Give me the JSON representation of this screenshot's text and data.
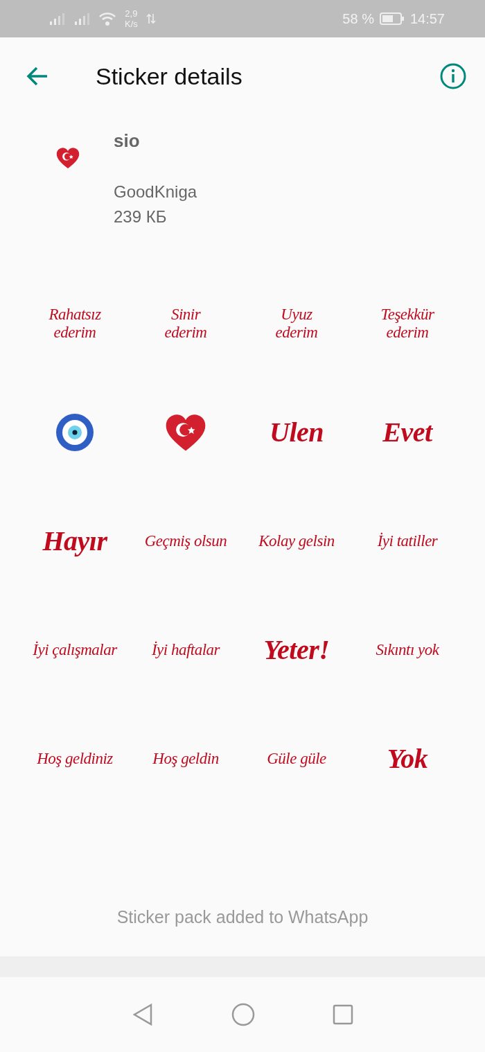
{
  "status_bar": {
    "network_speed": "2,9\nK/s",
    "battery": "58 %",
    "time": "14:57"
  },
  "app_bar": {
    "title": "Sticker details"
  },
  "pack": {
    "name": "sio",
    "publisher": "GoodKniga",
    "size": "239 КБ"
  },
  "stickers": [
    {
      "kind": "text",
      "label": "Rahatsız\nederim"
    },
    {
      "kind": "text",
      "label": "Sinir\nederim"
    },
    {
      "kind": "text",
      "label": "Uyuz\nederim"
    },
    {
      "kind": "text",
      "label": "Teşekkür\nederim"
    },
    {
      "kind": "eye"
    },
    {
      "kind": "heart"
    },
    {
      "kind": "big-text",
      "label": "Ulen"
    },
    {
      "kind": "big-text",
      "label": "Evet"
    },
    {
      "kind": "big-text",
      "label": "Hayır"
    },
    {
      "kind": "text",
      "label": "Geçmiş olsun"
    },
    {
      "kind": "text",
      "label": "Kolay gelsin"
    },
    {
      "kind": "text",
      "label": "İyi tatiller"
    },
    {
      "kind": "text",
      "label": "İyi çalışmalar"
    },
    {
      "kind": "text",
      "label": "İyi haftalar"
    },
    {
      "kind": "big-text",
      "label": "Yeter!"
    },
    {
      "kind": "text",
      "label": "Sıkıntı yok"
    },
    {
      "kind": "text",
      "label": "Hoş geldiniz"
    },
    {
      "kind": "text",
      "label": "Hoş geldin"
    },
    {
      "kind": "text",
      "label": "Güle güle"
    },
    {
      "kind": "big-text",
      "label": "Yok"
    }
  ],
  "footer": {
    "status": "Sticker pack added to WhatsApp"
  }
}
